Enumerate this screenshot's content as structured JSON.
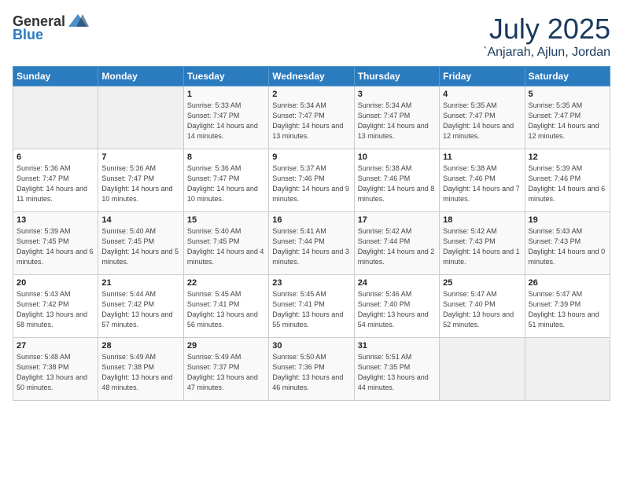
{
  "header": {
    "logo_general": "General",
    "logo_blue": "Blue",
    "month": "July 2025",
    "location": "`Anjarah, Ajlun, Jordan"
  },
  "days_of_week": [
    "Sunday",
    "Monday",
    "Tuesday",
    "Wednesday",
    "Thursday",
    "Friday",
    "Saturday"
  ],
  "weeks": [
    [
      {
        "day": "",
        "empty": true
      },
      {
        "day": "",
        "empty": true
      },
      {
        "day": "1",
        "sunrise": "Sunrise: 5:33 AM",
        "sunset": "Sunset: 7:47 PM",
        "daylight": "Daylight: 14 hours and 14 minutes."
      },
      {
        "day": "2",
        "sunrise": "Sunrise: 5:34 AM",
        "sunset": "Sunset: 7:47 PM",
        "daylight": "Daylight: 14 hours and 13 minutes."
      },
      {
        "day": "3",
        "sunrise": "Sunrise: 5:34 AM",
        "sunset": "Sunset: 7:47 PM",
        "daylight": "Daylight: 14 hours and 13 minutes."
      },
      {
        "day": "4",
        "sunrise": "Sunrise: 5:35 AM",
        "sunset": "Sunset: 7:47 PM",
        "daylight": "Daylight: 14 hours and 12 minutes."
      },
      {
        "day": "5",
        "sunrise": "Sunrise: 5:35 AM",
        "sunset": "Sunset: 7:47 PM",
        "daylight": "Daylight: 14 hours and 12 minutes."
      }
    ],
    [
      {
        "day": "6",
        "sunrise": "Sunrise: 5:36 AM",
        "sunset": "Sunset: 7:47 PM",
        "daylight": "Daylight: 14 hours and 11 minutes."
      },
      {
        "day": "7",
        "sunrise": "Sunrise: 5:36 AM",
        "sunset": "Sunset: 7:47 PM",
        "daylight": "Daylight: 14 hours and 10 minutes."
      },
      {
        "day": "8",
        "sunrise": "Sunrise: 5:36 AM",
        "sunset": "Sunset: 7:47 PM",
        "daylight": "Daylight: 14 hours and 10 minutes."
      },
      {
        "day": "9",
        "sunrise": "Sunrise: 5:37 AM",
        "sunset": "Sunset: 7:46 PM",
        "daylight": "Daylight: 14 hours and 9 minutes."
      },
      {
        "day": "10",
        "sunrise": "Sunrise: 5:38 AM",
        "sunset": "Sunset: 7:46 PM",
        "daylight": "Daylight: 14 hours and 8 minutes."
      },
      {
        "day": "11",
        "sunrise": "Sunrise: 5:38 AM",
        "sunset": "Sunset: 7:46 PM",
        "daylight": "Daylight: 14 hours and 7 minutes."
      },
      {
        "day": "12",
        "sunrise": "Sunrise: 5:39 AM",
        "sunset": "Sunset: 7:46 PM",
        "daylight": "Daylight: 14 hours and 6 minutes."
      }
    ],
    [
      {
        "day": "13",
        "sunrise": "Sunrise: 5:39 AM",
        "sunset": "Sunset: 7:45 PM",
        "daylight": "Daylight: 14 hours and 6 minutes."
      },
      {
        "day": "14",
        "sunrise": "Sunrise: 5:40 AM",
        "sunset": "Sunset: 7:45 PM",
        "daylight": "Daylight: 14 hours and 5 minutes."
      },
      {
        "day": "15",
        "sunrise": "Sunrise: 5:40 AM",
        "sunset": "Sunset: 7:45 PM",
        "daylight": "Daylight: 14 hours and 4 minutes."
      },
      {
        "day": "16",
        "sunrise": "Sunrise: 5:41 AM",
        "sunset": "Sunset: 7:44 PM",
        "daylight": "Daylight: 14 hours and 3 minutes."
      },
      {
        "day": "17",
        "sunrise": "Sunrise: 5:42 AM",
        "sunset": "Sunset: 7:44 PM",
        "daylight": "Daylight: 14 hours and 2 minutes."
      },
      {
        "day": "18",
        "sunrise": "Sunrise: 5:42 AM",
        "sunset": "Sunset: 7:43 PM",
        "daylight": "Daylight: 14 hours and 1 minute."
      },
      {
        "day": "19",
        "sunrise": "Sunrise: 5:43 AM",
        "sunset": "Sunset: 7:43 PM",
        "daylight": "Daylight: 14 hours and 0 minutes."
      }
    ],
    [
      {
        "day": "20",
        "sunrise": "Sunrise: 5:43 AM",
        "sunset": "Sunset: 7:42 PM",
        "daylight": "Daylight: 13 hours and 58 minutes."
      },
      {
        "day": "21",
        "sunrise": "Sunrise: 5:44 AM",
        "sunset": "Sunset: 7:42 PM",
        "daylight": "Daylight: 13 hours and 57 minutes."
      },
      {
        "day": "22",
        "sunrise": "Sunrise: 5:45 AM",
        "sunset": "Sunset: 7:41 PM",
        "daylight": "Daylight: 13 hours and 56 minutes."
      },
      {
        "day": "23",
        "sunrise": "Sunrise: 5:45 AM",
        "sunset": "Sunset: 7:41 PM",
        "daylight": "Daylight: 13 hours and 55 minutes."
      },
      {
        "day": "24",
        "sunrise": "Sunrise: 5:46 AM",
        "sunset": "Sunset: 7:40 PM",
        "daylight": "Daylight: 13 hours and 54 minutes."
      },
      {
        "day": "25",
        "sunrise": "Sunrise: 5:47 AM",
        "sunset": "Sunset: 7:40 PM",
        "daylight": "Daylight: 13 hours and 52 minutes."
      },
      {
        "day": "26",
        "sunrise": "Sunrise: 5:47 AM",
        "sunset": "Sunset: 7:39 PM",
        "daylight": "Daylight: 13 hours and 51 minutes."
      }
    ],
    [
      {
        "day": "27",
        "sunrise": "Sunrise: 5:48 AM",
        "sunset": "Sunset: 7:38 PM",
        "daylight": "Daylight: 13 hours and 50 minutes."
      },
      {
        "day": "28",
        "sunrise": "Sunrise: 5:49 AM",
        "sunset": "Sunset: 7:38 PM",
        "daylight": "Daylight: 13 hours and 48 minutes."
      },
      {
        "day": "29",
        "sunrise": "Sunrise: 5:49 AM",
        "sunset": "Sunset: 7:37 PM",
        "daylight": "Daylight: 13 hours and 47 minutes."
      },
      {
        "day": "30",
        "sunrise": "Sunrise: 5:50 AM",
        "sunset": "Sunset: 7:36 PM",
        "daylight": "Daylight: 13 hours and 46 minutes."
      },
      {
        "day": "31",
        "sunrise": "Sunrise: 5:51 AM",
        "sunset": "Sunset: 7:35 PM",
        "daylight": "Daylight: 13 hours and 44 minutes."
      },
      {
        "day": "",
        "empty": true
      },
      {
        "day": "",
        "empty": true
      }
    ]
  ]
}
